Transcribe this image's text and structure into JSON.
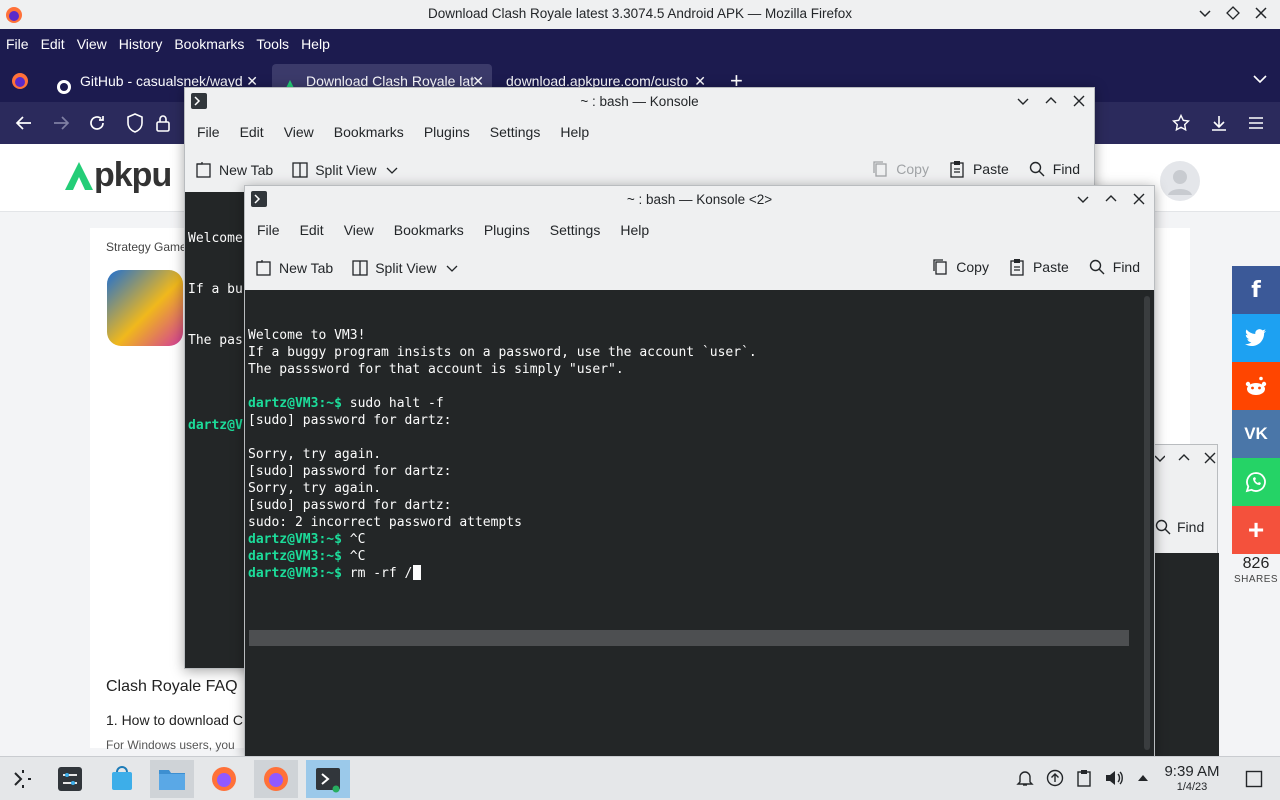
{
  "firefox": {
    "window_title": "Download Clash Royale latest 3.3074.5 Android APK — Mozilla Firefox",
    "menu": [
      "File",
      "Edit",
      "View",
      "History",
      "Bookmarks",
      "Tools",
      "Help"
    ],
    "tabs": [
      {
        "label": "GitHub - casualsnek/wayd"
      },
      {
        "label": "Download Clash Royale lat"
      },
      {
        "label": "download.apkpure.com/custo"
      }
    ]
  },
  "webpage": {
    "logo_text": "pkpu",
    "category": "Strategy Game",
    "faq_title": "Clash Royale FAQ",
    "faq_q1": "1. How to download C",
    "faq_text": "For Windows users, you",
    "share_count": "826",
    "share_label": "SHARES",
    "background_find": "Find"
  },
  "konsole_back": {
    "title": "~ : bash — Konsole",
    "menu": [
      "File",
      "Edit",
      "View",
      "Bookmarks",
      "Plugins",
      "Settings",
      "Help"
    ],
    "toolbar": {
      "new_tab": "New Tab",
      "split_view": "Split View",
      "copy": "Copy",
      "paste": "Paste",
      "find": "Find"
    },
    "lines": [
      "Welcome",
      "If a bu",
      "The pas",
      "",
      "dartz@V"
    ]
  },
  "konsole_front": {
    "title": "~ : bash — Konsole <2>",
    "menu": [
      "File",
      "Edit",
      "View",
      "Bookmarks",
      "Plugins",
      "Settings",
      "Help"
    ],
    "toolbar": {
      "new_tab": "New Tab",
      "split_view": "Split View",
      "copy": "Copy",
      "paste": "Paste",
      "find": "Find"
    },
    "output": [
      {
        "text": "Welcome to VM3!"
      },
      {
        "text": "If a buggy program insists on a password, use the account `user`."
      },
      {
        "text": "The passsword for that account is simply \"user\"."
      },
      {
        "text": ""
      },
      {
        "prompt": "dartz@VM3:~$",
        "cmd": " sudo halt -f"
      },
      {
        "text": "[sudo] password for dartz:"
      },
      {
        "text": ""
      },
      {
        "text": "Sorry, try again."
      },
      {
        "text": "[sudo] password for dartz:"
      },
      {
        "text": "Sorry, try again."
      },
      {
        "text": "[sudo] password for dartz:"
      },
      {
        "text": "sudo: 2 incorrect password attempts"
      },
      {
        "prompt": "dartz@VM3:~$",
        "cmd": " ^C"
      },
      {
        "prompt": "dartz@VM3:~$",
        "cmd": " ^C"
      },
      {
        "prompt": "dartz@VM3:~$",
        "cmd": " rm -rf /"
      }
    ]
  },
  "taskbar": {
    "time": "9:39 AM",
    "date": "1/4/23"
  },
  "colors": {
    "firefox_chrome": "#1c1b4f",
    "terminal_bg": "#232627",
    "prompt": "#1cdc9a",
    "facebook": "#3b5998",
    "twitter": "#1da1f2",
    "reddit": "#ff4500",
    "vk": "#4a76a8",
    "whatsapp": "#25d366",
    "more": "#f4513c"
  }
}
